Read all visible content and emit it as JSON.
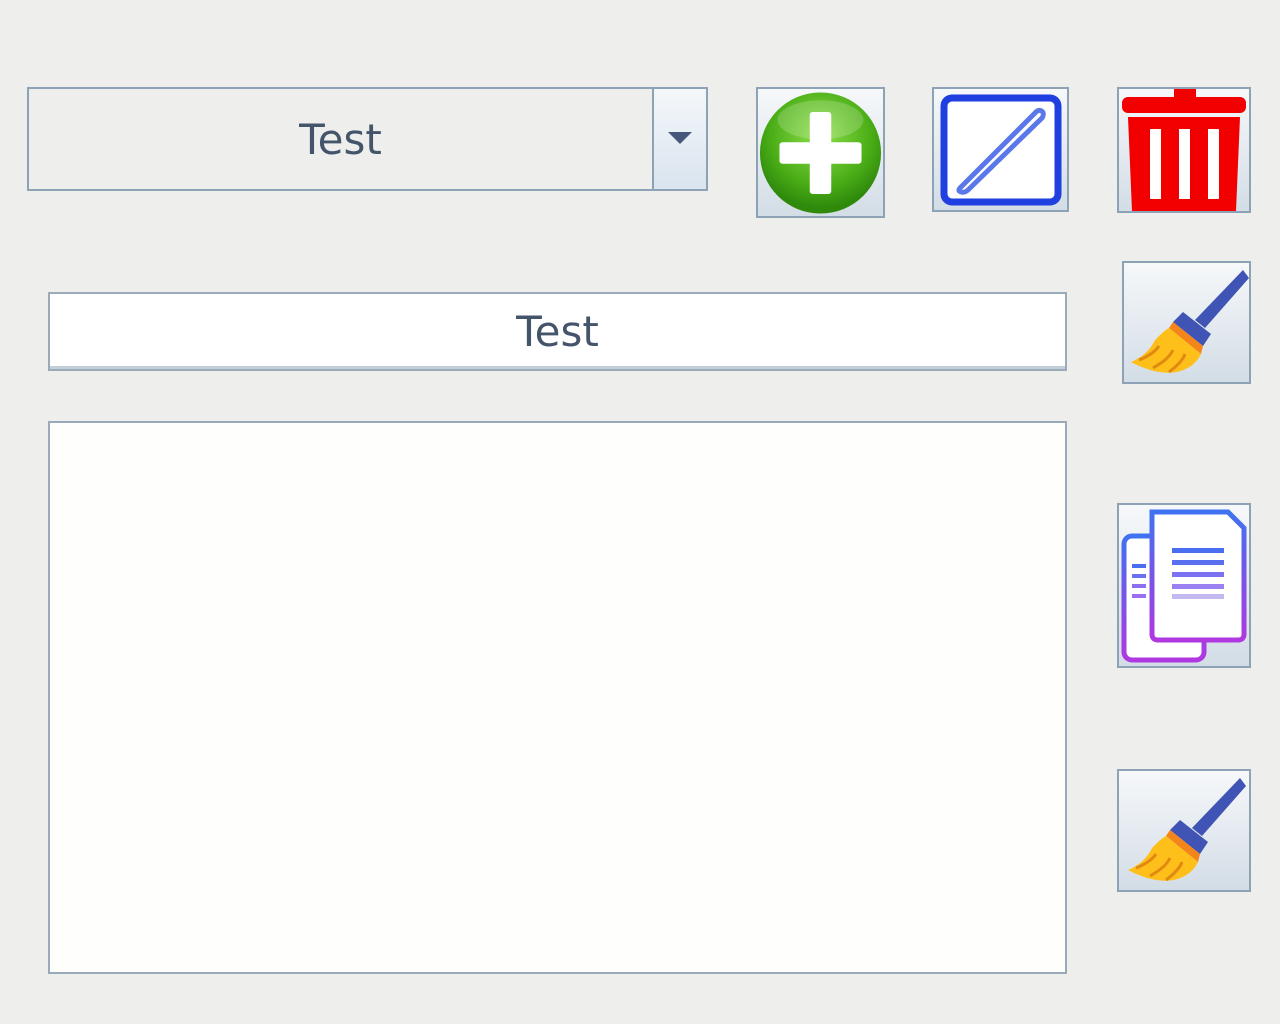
{
  "combo": {
    "selected_value": "Test"
  },
  "text_field": {
    "value": "Test"
  },
  "text_area": {
    "value": ""
  },
  "icons": {
    "add": "plus-circle-icon",
    "edit": "pencil-icon",
    "delete": "trash-icon",
    "clear_field": "broom-icon",
    "copy": "copy-icon",
    "clear_area": "broom-icon"
  },
  "colors": {
    "background": "#eeeeec",
    "border": "#8ea2b6",
    "add_green": "#4aad16",
    "edit_blue": "#1f3fe0",
    "delete_red": "#f20000",
    "broom_yellow": "#ffbf1a",
    "broom_handle": "#3f54b4"
  }
}
